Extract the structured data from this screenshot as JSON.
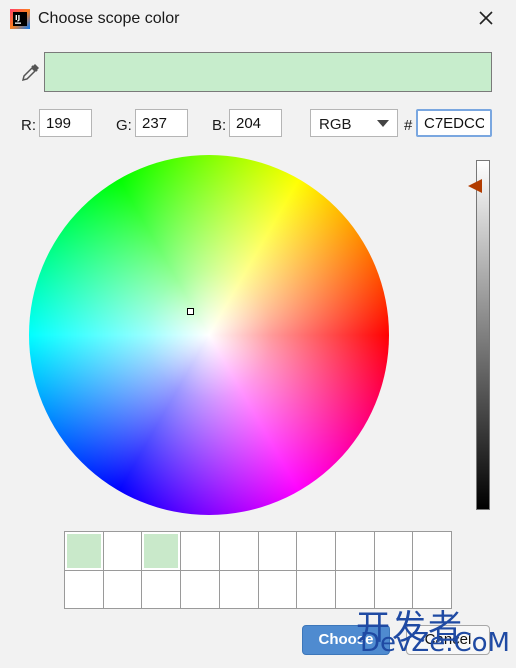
{
  "window": {
    "title": "Choose scope color",
    "app_icon": "intellij-icon",
    "close_icon": "close-icon"
  },
  "preview": {
    "color": "#C7EDCC",
    "eyedropper_icon": "eyedropper-icon"
  },
  "fields": {
    "r_label": "R:",
    "r_value": "199",
    "g_label": "G:",
    "g_value": "237",
    "b_label": "B:",
    "b_value": "204",
    "mode": "RGB",
    "hash": "#",
    "hex_value": "C7EDCC"
  },
  "wheel": {
    "selected_color": "#C7EDCC"
  },
  "brightness": {
    "level": 0.96,
    "handle_color": "#b23c00"
  },
  "recent_colors": [
    "#c9e9ca",
    "#ffffff",
    "#c9e9ca",
    "#ffffff",
    "#ffffff",
    "#ffffff",
    "#ffffff",
    "#ffffff",
    "#ffffff",
    "#ffffff",
    "#ffffff",
    "#ffffff",
    "#ffffff",
    "#ffffff",
    "#ffffff",
    "#ffffff",
    "#ffffff",
    "#ffffff",
    "#ffffff",
    "#ffffff"
  ],
  "buttons": {
    "choose_label": "Choose",
    "cancel_label": "Cancel",
    "accent": "#4f8bd0"
  },
  "watermark": {
    "line1": "开发者",
    "line2": "DevZe.CoM"
  }
}
